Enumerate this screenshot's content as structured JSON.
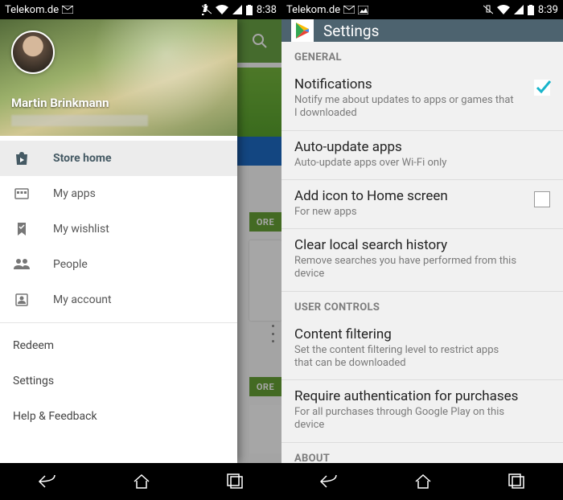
{
  "left": {
    "status": {
      "carrier": "Telekom.de",
      "time": "8:38"
    },
    "drawer": {
      "user_name": "Martin Brinkmann",
      "items": [
        {
          "label": "Store home",
          "icon": "bag-play-icon"
        },
        {
          "label": "My apps",
          "icon": "grid-icon"
        },
        {
          "label": "My wishlist",
          "icon": "bookmark-check-icon"
        },
        {
          "label": "People",
          "icon": "people-icon"
        },
        {
          "label": "My account",
          "icon": "account-icon"
        }
      ],
      "footer": [
        {
          "label": "Redeem"
        },
        {
          "label": "Settings"
        },
        {
          "label": "Help & Feedback"
        }
      ]
    },
    "peek": {
      "more_label": "ORE"
    }
  },
  "right": {
    "status": {
      "carrier": "Telekom.de",
      "time": "8:39"
    },
    "appbar_title": "Settings",
    "sections": {
      "general": {
        "header": "GENERAL",
        "notifications": {
          "title": "Notifications",
          "sub": "Notify me about updates to apps or games that I downloaded",
          "checked": true
        },
        "auto_update": {
          "title": "Auto-update apps",
          "sub": "Auto-update apps over Wi-Fi only"
        },
        "add_icon": {
          "title": "Add icon to Home screen",
          "sub": "For new apps",
          "checked": false
        },
        "clear_history": {
          "title": "Clear local search history",
          "sub": "Remove searches you have performed from this device"
        }
      },
      "user_controls": {
        "header": "USER CONTROLS",
        "content_filtering": {
          "title": "Content filtering",
          "sub": "Set the content filtering level to restrict apps that can be downloaded"
        },
        "require_auth": {
          "title": "Require authentication for purchases",
          "sub": "For all purchases through Google Play on this device"
        }
      },
      "about": {
        "header": "ABOUT"
      }
    }
  }
}
